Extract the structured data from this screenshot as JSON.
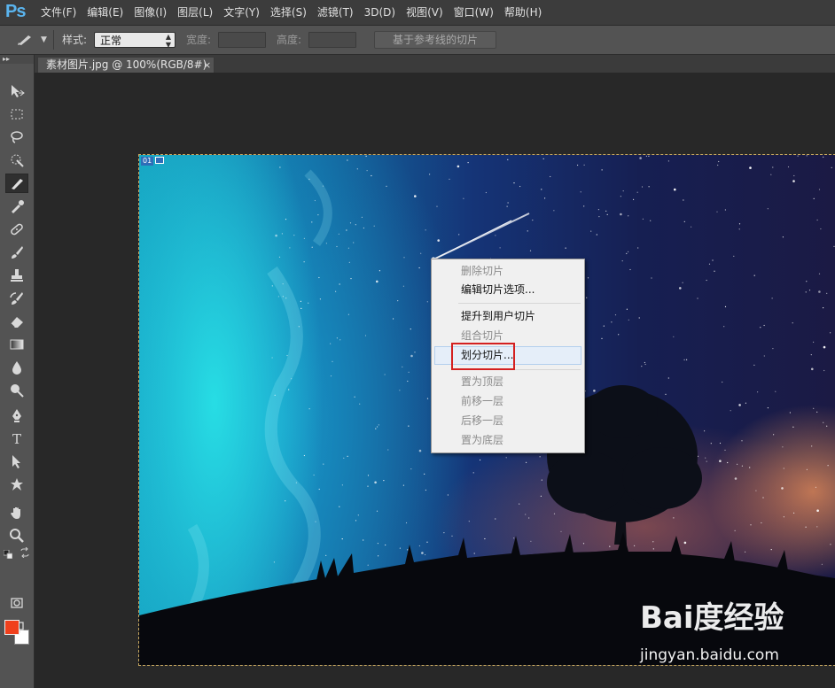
{
  "app": {
    "logo": "Ps",
    "menus": [
      "文件(F)",
      "编辑(E)",
      "图像(I)",
      "图层(L)",
      "文字(Y)",
      "选择(S)",
      "滤镜(T)",
      "3D(D)",
      "视图(V)",
      "窗口(W)",
      "帮助(H)"
    ]
  },
  "options_bar": {
    "style_label": "样式:",
    "style_value": "正常",
    "width_label": "宽度:",
    "height_label": "高度:",
    "slice_from_guides": "基于参考线的切片"
  },
  "document": {
    "tab_title": "素材图片.jpg @ 100%(RGB/8#)",
    "close_glyph": "×",
    "slice_number": "01"
  },
  "context_menu": {
    "items": [
      {
        "label": "删除切片",
        "enabled": false
      },
      {
        "label": "编辑切片选项...",
        "enabled": true
      },
      {
        "label": "提升到用户切片",
        "enabled": true
      },
      {
        "label": "组合切片",
        "enabled": false
      },
      {
        "label": "划分切片...",
        "enabled": true,
        "highlighted": true
      },
      {
        "label": "置为顶层",
        "enabled": false
      },
      {
        "label": "前移一层",
        "enabled": false
      },
      {
        "label": "后移一层",
        "enabled": false
      },
      {
        "label": "置为底层",
        "enabled": false
      }
    ]
  },
  "colors": {
    "foreground": "#f0401c",
    "background": "#ffffff",
    "highlight_box": "#d42020"
  },
  "watermark": {
    "logo": "Bai度经验",
    "url": "jingyan.baidu.com"
  },
  "tools": [
    "move-icon",
    "rect-marquee-icon",
    "lasso-icon",
    "quick-select-icon",
    "slice-icon",
    "eyedropper-icon",
    "healing-brush-icon",
    "brush-icon",
    "stamp-icon",
    "history-brush-icon",
    "eraser-icon",
    "gradient-icon",
    "blur-icon",
    "dodge-icon",
    "pen-icon",
    "type-icon",
    "path-select-icon",
    "shape-icon",
    "hand-icon",
    "zoom-icon"
  ]
}
